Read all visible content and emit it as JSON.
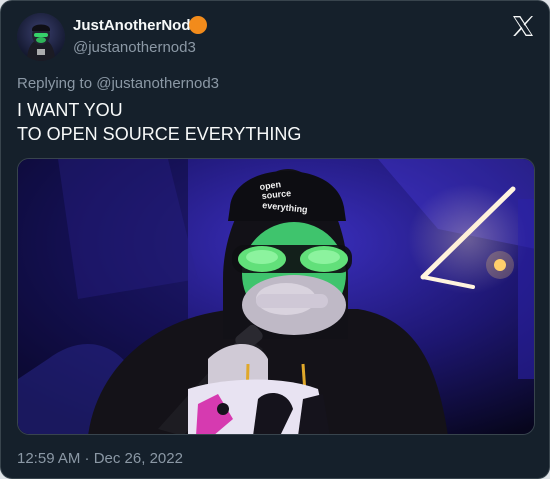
{
  "author": {
    "display_name": "JustAnotherNode",
    "handle": "@justanothernod3",
    "avatar_icon": "hooded-figure-avatar",
    "badge_color": "#f28b1b"
  },
  "brand": {
    "logo_icon": "x-logo-icon"
  },
  "reply": {
    "text": "Replying to @justanothernod3"
  },
  "tweet": {
    "lines": [
      "I WANT YOU",
      "TO OPEN SOURCE EVERYTHING"
    ]
  },
  "media": {
    "cap_text": [
      "open",
      "source",
      "everything"
    ]
  },
  "meta": {
    "timestamp": "12:59 AM · Dec 26, 2022"
  },
  "colors": {
    "background": "#15202b",
    "text_primary": "#f7f9f9",
    "text_secondary": "#8b98a5",
    "border": "#38444d"
  }
}
